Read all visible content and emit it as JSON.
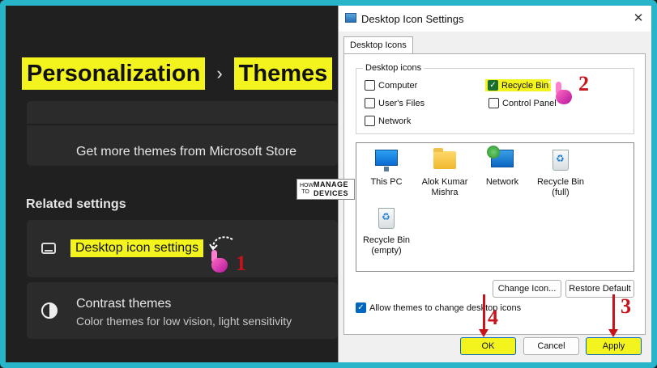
{
  "settings": {
    "breadcrumb_parent": "Personalization",
    "breadcrumb_separator": "›",
    "breadcrumb_current": "Themes",
    "store_link": "Get more themes from Microsoft Store",
    "related_settings_title": "Related settings",
    "desktop_icon_settings_label": "Desktop icon settings",
    "contrast_title": "Contrast themes",
    "contrast_subtitle": "Color themes for low vision, light sensitivity"
  },
  "dialog": {
    "title": "Desktop Icon Settings",
    "close_glyph": "✕",
    "tab_label": "Desktop Icons",
    "group_title": "Desktop icons",
    "checkboxes": [
      {
        "label": "Computer",
        "checked": false
      },
      {
        "label": "Recycle Bin",
        "checked": true
      },
      {
        "label": "User's Files",
        "checked": false
      },
      {
        "label": "Control Panel",
        "checked": false
      },
      {
        "label": "Network",
        "checked": false
      }
    ],
    "icons": [
      {
        "icon": "this-pc-icon",
        "label": "This PC"
      },
      {
        "icon": "user-folder-icon",
        "label": "Alok Kumar Mishra"
      },
      {
        "icon": "network-icon",
        "label": "Network"
      },
      {
        "icon": "recycle-bin-full-icon",
        "label": "Recycle Bin (full)"
      },
      {
        "icon": "recycle-bin-empty-icon",
        "label": "Recycle Bin (empty)"
      }
    ],
    "change_icon_button": "Change Icon...",
    "restore_default_button": "Restore Default",
    "allow_themes_label": "Allow themes to change desktop icons",
    "allow_themes_checked": true,
    "ok_button": "OK",
    "cancel_button": "Cancel",
    "apply_button": "Apply"
  },
  "annotations": {
    "step1": "1",
    "step2": "2",
    "step3": "3",
    "step4": "4"
  },
  "watermark": {
    "how": "HOW TO",
    "manage": "MANAGE",
    "devices": "DEVICES"
  },
  "colors": {
    "highlight": "#f3f31e",
    "frame": "#29b5c9",
    "annotation_red": "#c6141c",
    "checkbox_blue": "#0067c0"
  }
}
